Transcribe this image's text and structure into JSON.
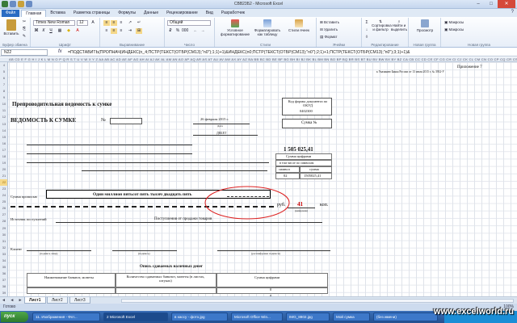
{
  "window": {
    "title": "СВВ23Б2 - Microsoft Excel",
    "buttons": {
      "minimize": "–",
      "maximize": "□",
      "close": "✕"
    }
  },
  "ribbon": {
    "file_tab": "Файл",
    "tabs": [
      "Главная",
      "Вставка",
      "Разметка страницы",
      "Формулы",
      "Данные",
      "Рецензирование",
      "Вид",
      "Разработчик"
    ],
    "active_tab": "Главная",
    "groups": {
      "clipboard": {
        "name": "Буфер обмена",
        "paste": "Вставить"
      },
      "font": {
        "name": "Шрифт",
        "font_name": "Times New Roman",
        "font_size": "12",
        "bold": "Ж",
        "italic": "К",
        "underline": "Ч"
      },
      "alignment": {
        "name": "Выравнивание"
      },
      "number": {
        "name": "Число",
        "format": "Общий"
      },
      "styles": {
        "name": "Стили",
        "conditional": "Условное форматирование",
        "as_table": "Форматировать как таблицу",
        "cell_styles": "Стили ячеек"
      },
      "cells": {
        "name": "Ячейки",
        "insert": "Вставить",
        "delete": "Удалить",
        "format": "Формат"
      },
      "editing": {
        "name": "Редактирование",
        "sort": "Сортировка и фильтр",
        "find": "Найти и выделить"
      },
      "new": {
        "name": "Новая группа",
        "print": "Просмотр"
      },
      "macro": {
        "name": "Новая группа",
        "macros": "Макросы",
        "macros2": "Макросы"
      }
    }
  },
  "formula_bar": {
    "name_box": "N22",
    "fx": "fx",
    "formula": "=ПОДСТАВИТЬ(ПРОПНАЧ(ИНДЕКС(n_4;ПСТР(ТЕКСТ(ОТБР(CM13);\"n0\");1;1)+1)&ИНДЕКС(n0;ПСТР(ТЕКСТ(ОТБР(CM13);\"n0\");2;1)+1;ПСТР(ТЕКСТ(ОТБР(CM13);\"n0\");3;1)+1)&"
  },
  "column_headers": "AB CD E F G H I J K L M N O P Q R S T U V W X Y Z AA AB AC AD AE AF AG AH AI AJ AK AL AM AN AO AP AQ AR AS AT AU AV AW AX AY AZ BA BB BC BD BE BF BG BH BI BJ BK BL BM BN BO BP BQ BR BS BT BU BV BW BX BY BZ CA CB CC CD CE CF CG CH CI CJ CK CL CM CN CO CP CQ CR CS CT CU CV CW CX CY CZ DA DB DC DD",
  "rows": [
    "4",
    "5",
    "6",
    "7",
    "8",
    "9",
    "10",
    "11",
    "12",
    "13",
    "14",
    "15",
    "16",
    "17",
    "18",
    "19",
    "20",
    "21",
    "22",
    "23",
    "24",
    "25",
    "26",
    "27",
    "28",
    "29",
    "30",
    "31",
    "32",
    "33",
    "34",
    "35",
    "36",
    "37",
    "38",
    "39"
  ],
  "selected_row": "22",
  "document": {
    "appendix": "Приложение 7",
    "appendix_note": "к Указанию Банка России от 13 июля 2015 г. № 3932-У",
    "doc_title": "Препроводительная ведомость к сумке",
    "form_code_label": "Код формы документа по ОКУД",
    "form_code": "0402300",
    "vedomost": "ВЕДОМОСТЬ К СУМКЕ",
    "number_sign": "№",
    "date_value": "26 февраля 2015 г.",
    "date_label": "Дата",
    "bag_label": "Сумка №",
    "other_label": "ДЕБЕТ",
    "amount": "1 505 025,41",
    "amount_digits_label": "Сумма цифрами",
    "incl_label": "в том числе по символам",
    "symbol_col": "символ",
    "sum_col": "сумма",
    "symbol_val": "02",
    "sum_val": "1505025,41",
    "sum_words_label": "Сумма прописью",
    "sum_words": "Один миллион пятьсот пять тысяч двадцать пять",
    "rub_label": "руб.",
    "kop_value": "41",
    "kop_label": "коп.",
    "kop_sub": "(цифрами)",
    "source_label": "Источник поступлений",
    "source_value": "Поступления от продажи товаров",
    "signer_label": "Клиент",
    "sign_sub1": "(подпись лица)",
    "sign_sub2": "(подпись)",
    "sign_sub3": "(расшифровка подписи)",
    "list_title": "Опись сдаваемых наличных денег",
    "table_col1": "Наименование банкнот, монеты",
    "table_col2": "Количество сдаваемых банкнот, монеты (в листах, штуках)",
    "table_col3": "Сумма цифрами",
    "zero1": "0",
    "zero2": "0"
  },
  "sheet_tabs": {
    "nav": "◄ ◄ ► ►",
    "tabs": [
      "Лист1",
      "Лист2",
      "Лист3"
    ],
    "active": "Лист1"
  },
  "status": {
    "ready": "Готово",
    "zoom": "100%"
  },
  "taskbar": {
    "start": "пуск",
    "items": [
      "11. Изображения - Фот...",
      "2 Microsoft Excel",
      "в кассу - фото.jpg",
      "Microsoft Office Win...",
      "IMG_8802.jpg",
      "Мой сумка",
      "(без имени)"
    ],
    "active": "2 Microsoft Excel"
  },
  "watermark": "www.excelworld.ru"
}
